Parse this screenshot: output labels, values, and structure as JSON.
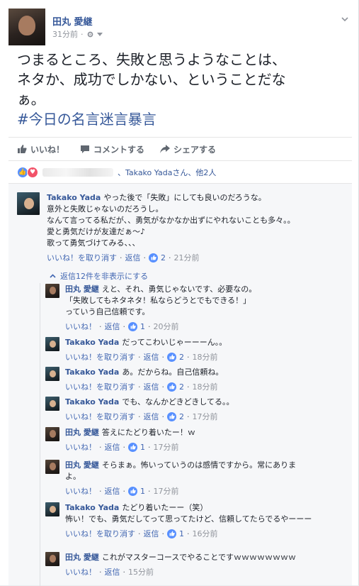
{
  "post": {
    "author": "田丸 愛継",
    "time": "31分前",
    "text_line1": "つまるところ、失敗と思うようなことは、",
    "text_line2": "ネタか、成功でしかない、ということだな",
    "text_line3": "ぁ。",
    "hashtag": "#今日の名言迷言暴言"
  },
  "actions": {
    "like": "いいね！",
    "comment": "コメントする",
    "share": "シェアする"
  },
  "reactions": {
    "summary_tail": "、Takako Yadaさん、他2人"
  },
  "top_comment": {
    "author": "Takako Yada",
    "line1": "やった後で「失敗」にしても良いのだろうな。",
    "line2": "意外と失敗じゃないのだろうし。",
    "line3": "なんて言ってる私だが、、勇気がなかなか出ずにやれないことも多々。。",
    "line4": "愛と勇気だけが友達だぁ〜♪",
    "line5": "歌って勇気づけてみる、、、",
    "unlike": "いいね！を取り消す",
    "reply": "返信",
    "likes": "2",
    "time": "21分前",
    "hide_replies": "返信12件を非表示にする"
  },
  "replies": [
    {
      "author": "田丸 愛継",
      "avatar": "tamaru",
      "lines": [
        "えと、それ、勇気じゃないです、必要なの。",
        "「失敗してもネタネタ！私ならどうとでもできる！」",
        "っていう自己信頼です。"
      ],
      "like_label": "いいね！",
      "likes": "1",
      "time": "20分前"
    },
    {
      "author": "Takako Yada",
      "avatar": "takako",
      "lines": [
        "だってこわいじゃーーーん。。"
      ],
      "like_label": "いいね！を取り消す",
      "likes": "2",
      "time": "18分前"
    },
    {
      "author": "Takako Yada",
      "avatar": "takako",
      "lines": [
        "あ。だからね。自己信頼ね。"
      ],
      "like_label": "いいね！を取り消す",
      "likes": "2",
      "time": "18分前"
    },
    {
      "author": "Takako Yada",
      "avatar": "takako",
      "lines": [
        "でも、なんかどきどきしてる。。"
      ],
      "like_label": "いいね！を取り消す",
      "likes": "2",
      "time": "17分前"
    },
    {
      "author": "田丸 愛継",
      "avatar": "tamaru",
      "lines": [
        "答えにたどり着いたー！ｗ"
      ],
      "like_label": "いいね！",
      "likes": "1",
      "time": "17分前"
    },
    {
      "author": "田丸 愛継",
      "avatar": "tamaru",
      "lines": [
        "そらまぁ。怖いっていうのは感情ですから。常にありま",
        "よ。"
      ],
      "like_label": "いいね！",
      "likes": "1",
      "time": "17分前"
    },
    {
      "author": "Takako Yada",
      "avatar": "takako",
      "lines": [
        "たどり着いたーー（笑）",
        "怖い！でも、勇気だしてって思ってたけど、信頼してたらでるやーーー"
      ],
      "like_label": "いいね！を取り消す",
      "likes": "1",
      "time": "16分前"
    },
    {
      "author": "田丸 愛継",
      "avatar": "tamaru",
      "lines": [
        "これがマスターコースでやることですｗｗｗｗｗｗｗｗ"
      ],
      "like_label": "いいね！",
      "likes": "",
      "time": "15分前"
    }
  ],
  "labels": {
    "reply": "返信"
  }
}
